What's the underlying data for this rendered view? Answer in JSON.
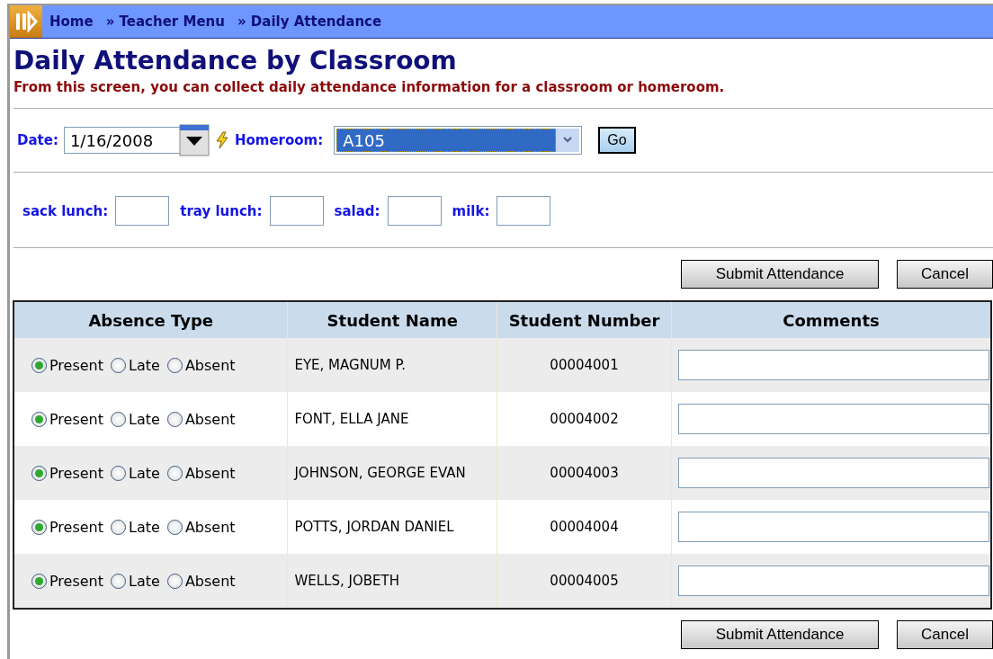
{
  "breadcrumb": [
    "Home",
    "» Teacher Menu",
    "» Daily Attendance"
  ],
  "title": "Daily Attendance by Classroom",
  "subtitle": "From this screen, you can collect daily attendance information for a classroom or homeroom.",
  "date": {
    "label": "Date:",
    "value": "1/16/2008"
  },
  "homeroom": {
    "label": "Homeroom:",
    "value": "A105"
  },
  "go_button": "Go",
  "lunch_fields": [
    {
      "label": "sack lunch:"
    },
    {
      "label": "tray lunch:"
    },
    {
      "label": "salad:"
    },
    {
      "label": "milk:"
    }
  ],
  "actions": [
    "Submit Attendance",
    "Cancel"
  ],
  "table": {
    "columns": [
      "Absence Type",
      "Student Name",
      "Student Number",
      "Comments"
    ],
    "rows": [
      {
        "options": [
          {
            "label": "Present",
            "selected": true
          },
          {
            "label": "Late",
            "selected": false
          },
          {
            "label": "Absent",
            "selected": false
          }
        ],
        "name": "EYE, MAGNUM P.",
        "number": "00004001"
      },
      {
        "options": [
          {
            "label": "Present",
            "selected": true
          },
          {
            "label": "Late",
            "selected": false
          },
          {
            "label": "Absent",
            "selected": false
          }
        ],
        "name": "FONT, ELLA JANE",
        "number": "00004002"
      },
      {
        "options": [
          {
            "label": "Present",
            "selected": true
          },
          {
            "label": "Late",
            "selected": false
          },
          {
            "label": "Absent",
            "selected": false
          }
        ],
        "name": "JOHNSON, GEORGE EVAN",
        "number": "00004003"
      },
      {
        "options": [
          {
            "label": "Present",
            "selected": true
          },
          {
            "label": "Late",
            "selected": false
          },
          {
            "label": "Absent",
            "selected": false
          }
        ],
        "name": "POTTS, JORDAN DANIEL",
        "number": "00004004"
      },
      {
        "options": [
          {
            "label": "Present",
            "selected": true
          },
          {
            "label": "Late",
            "selected": false
          },
          {
            "label": "Absent",
            "selected": false
          }
        ],
        "name": "WELLS, JOBETH",
        "number": "00004005"
      }
    ]
  },
  "bottom_actions": [
    "Submit Attendance",
    "Cancel"
  ]
}
